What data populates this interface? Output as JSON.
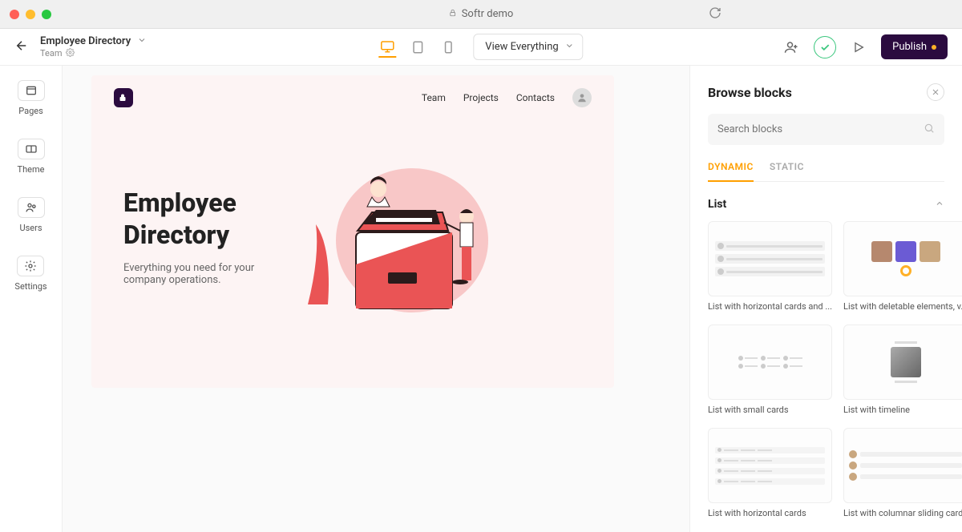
{
  "browser": {
    "title": "Softr demo"
  },
  "toolbar": {
    "project_name": "Employee Directory",
    "project_sub": "Team",
    "view_dropdown": "View Everything",
    "publish_label": "Publish"
  },
  "sidebar": {
    "items": [
      {
        "label": "Pages"
      },
      {
        "label": "Theme"
      },
      {
        "label": "Users"
      },
      {
        "label": "Settings"
      }
    ]
  },
  "canvas": {
    "nav": [
      "Team",
      "Projects",
      "Contacts"
    ],
    "hero_title_line1": "Employee",
    "hero_title_line2": "Directory",
    "hero_subtitle": "Everything you need for your company operations."
  },
  "right_panel": {
    "title": "Browse blocks",
    "search_placeholder": "Search blocks",
    "tabs": [
      "DYNAMIC",
      "STATIC"
    ],
    "section": "List",
    "blocks": [
      {
        "name": "List with horizontal cards and ..."
      },
      {
        "name": "List with deletable elements, v..."
      },
      {
        "name": "List with small cards"
      },
      {
        "name": "List with timeline"
      },
      {
        "name": "List with horizontal cards"
      },
      {
        "name": "List with columnar sliding cards"
      }
    ]
  }
}
